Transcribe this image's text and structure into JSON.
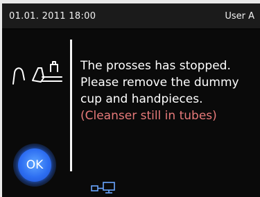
{
  "header": {
    "datetime": "01.01. 2011 18:00",
    "user": "User A"
  },
  "message": {
    "line1": "The prosses has stopped.",
    "line2": "Please remove the dummy",
    "line3": "cup and handpieces.",
    "note": "(Cleanser still in tubes)"
  },
  "ok_button": {
    "label": "OK"
  },
  "icons": {
    "left": "handpiece-icon",
    "bottom": "network-connection-icon"
  },
  "colors": {
    "background": "#0a0a0a",
    "header": "#1b1b1b",
    "text": "#ffffff",
    "note": "#e77a7a",
    "ok_button": "#2e6ff2"
  }
}
